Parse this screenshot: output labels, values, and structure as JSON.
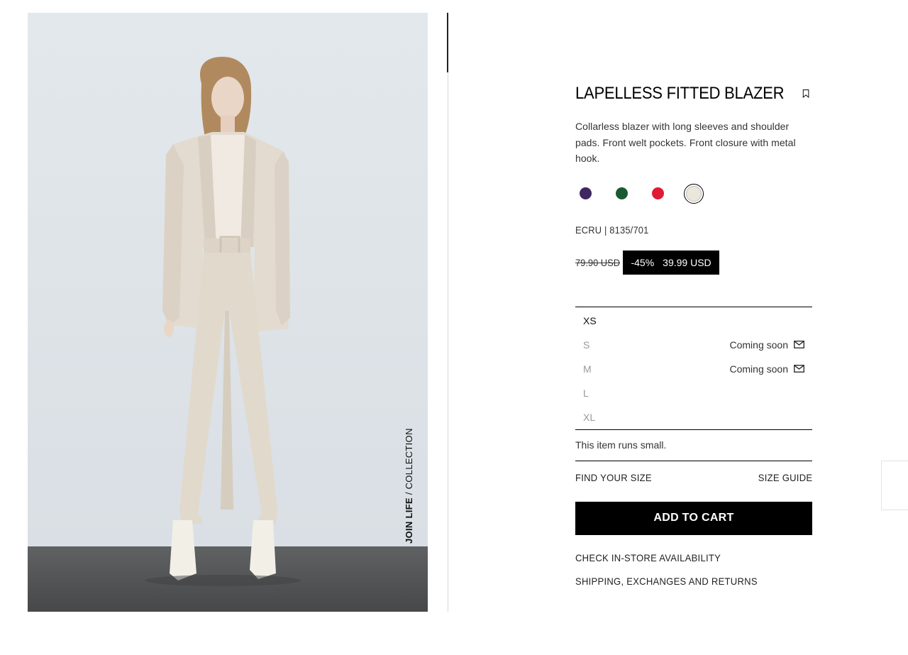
{
  "image": {
    "caption_bold": "JOIN LIFE",
    "caption_rest": " / COLLECTION"
  },
  "product": {
    "title": "LAPELLESS FITTED BLAZER",
    "description": "Collarless blazer with long sleeves and shoulder pads. Front welt pockets. Front closure with metal hook.",
    "bookmark_icon": "bookmark-icon",
    "colors": [
      {
        "name": "purple",
        "hex": "#3e2660",
        "selected": false
      },
      {
        "name": "green",
        "hex": "#1a5a30",
        "selected": false
      },
      {
        "name": "red",
        "hex": "#e01b35",
        "selected": false
      },
      {
        "name": "ecru",
        "hex": "#ece7dc",
        "selected": true
      }
    ],
    "reference": "ECRU | 8135/701",
    "price": {
      "original": "79.90 USD",
      "discount": "-45%",
      "sale": "39.99 USD"
    },
    "sizes": [
      {
        "label": "XS",
        "available": true,
        "status": ""
      },
      {
        "label": "S",
        "available": false,
        "status": "Coming soon"
      },
      {
        "label": "M",
        "available": false,
        "status": "Coming soon"
      },
      {
        "label": "L",
        "available": false,
        "status": ""
      },
      {
        "label": "XL",
        "available": false,
        "status": ""
      }
    ],
    "fit_note": "This item runs small.",
    "find_size": "FIND YOUR SIZE",
    "size_guide": "SIZE GUIDE",
    "add_to_cart": "ADD TO CART",
    "store_availability": "CHECK IN-STORE AVAILABILITY",
    "shipping": "SHIPPING, EXCHANGES AND RETURNS"
  }
}
